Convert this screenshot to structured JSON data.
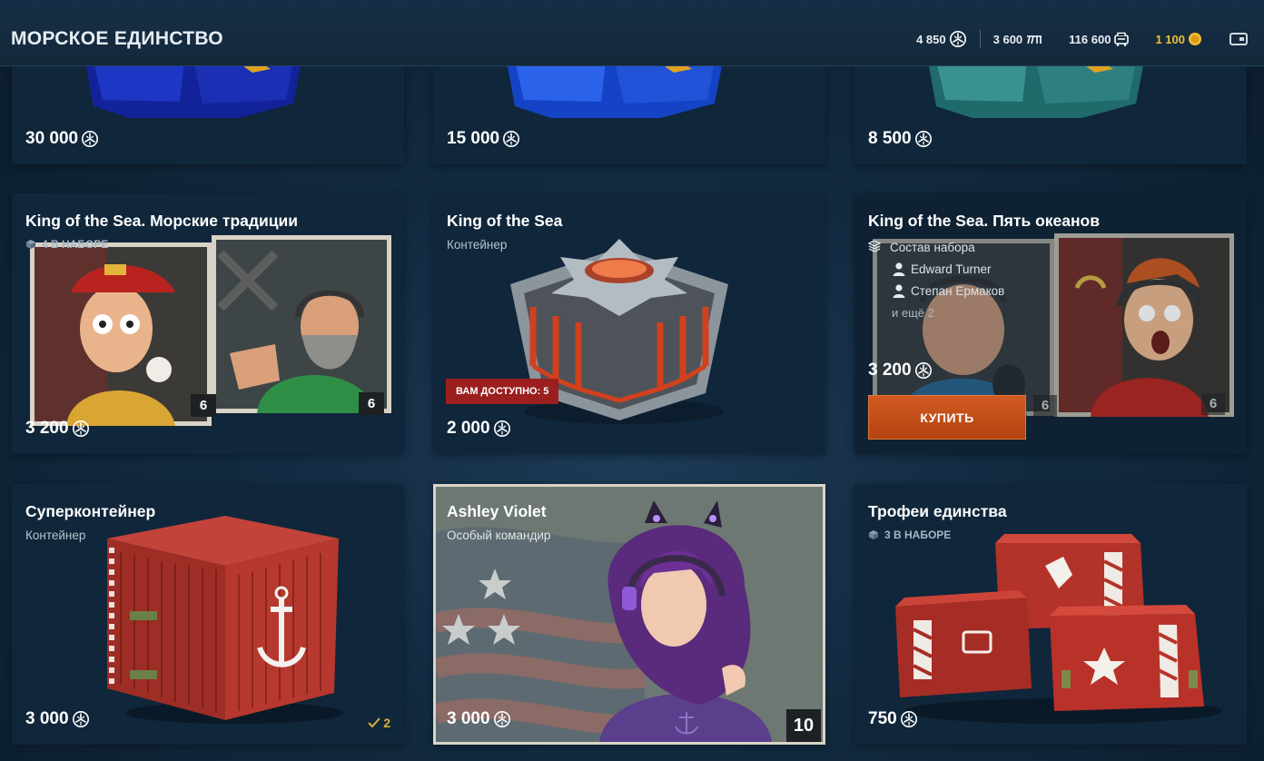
{
  "header": {
    "title": "МОРСКОЕ ЕДИНСТВО",
    "currencies": [
      {
        "value": "4 850",
        "icon": "unity-icon"
      },
      {
        "value": "3 600",
        "icon": "free-xp-icon"
      },
      {
        "value": "116 600",
        "icon": "credits-icon"
      },
      {
        "value": "1 100",
        "icon": "doubloons-icon",
        "color": "#f0c030"
      }
    ],
    "wallet_icon": "wallet-icon"
  },
  "top_row": [
    {
      "price": "30 000"
    },
    {
      "price": "15 000"
    },
    {
      "price": "8 500"
    }
  ],
  "cards": {
    "traditions": {
      "title": "King of the Sea. Морские традиции",
      "in_set": "4 В НАБОРЕ",
      "price": "3 200",
      "counts": [
        "6",
        "6"
      ]
    },
    "king": {
      "title": "King of the Sea",
      "subtitle": "Контейнер",
      "available": "ВАМ ДОСТУПНО: 5",
      "price": "2 000"
    },
    "oceans": {
      "title": "King of the Sea. Пять океанов",
      "set_label": "Состав набора",
      "items": [
        "Edward Turner",
        "Степан Ермаков"
      ],
      "more": "и ещё 2",
      "price": "3 200",
      "buy": "КУПИТЬ",
      "counts": [
        "6",
        "6"
      ]
    },
    "super": {
      "title": "Суперконтейнер",
      "subtitle": "Контейнер",
      "price": "3 000",
      "owned": "2"
    },
    "ashley": {
      "title": "Ashley Violet",
      "subtitle": "Особый командир",
      "price": "3 000",
      "count": "10"
    },
    "trophies": {
      "title": "Трофеи единства",
      "in_set": "3 В НАБОРЕ",
      "price": "750"
    }
  },
  "colors": {
    "accent_buy": "#c44e18",
    "available_badge": "#9b1f1f",
    "gold": "#f0c030"
  }
}
